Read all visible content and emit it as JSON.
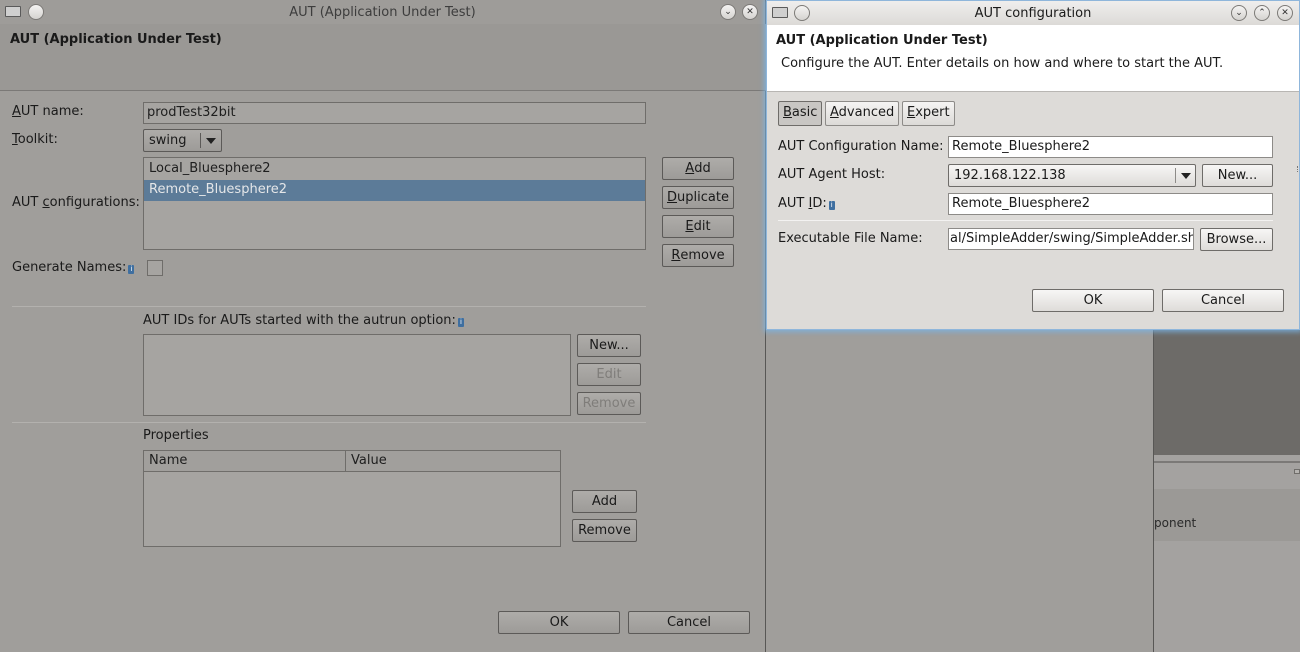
{
  "left_dialog": {
    "title": "AUT (Application Under Test)",
    "header_title": "AUT (Application Under Test)",
    "aut_name": {
      "label_u": "A",
      "label_rest": "UT name:",
      "value": "prodTest32bit"
    },
    "toolkit": {
      "label_u": "T",
      "label_rest": "oolkit:",
      "value": "swing"
    },
    "configs": {
      "label_pre": "AUT ",
      "label_u": "c",
      "label_rest": "onfigurations:",
      "items": [
        "Local_Bluesphere2",
        "Remote_Bluesphere2"
      ],
      "selected_index": 1
    },
    "config_buttons": {
      "add_u": "A",
      "add_rest": "dd",
      "duplicate_u": "D",
      "duplicate_rest": "uplicate",
      "edit_u": "E",
      "edit_rest": "dit",
      "remove_u": "R",
      "remove_rest": "emove"
    },
    "generate_names_label": "Generate Names:",
    "autrun_label": "AUT IDs for AUTs started with the autrun option:",
    "autrun_buttons": {
      "new": "New...",
      "edit": "Edit",
      "remove": "Remove"
    },
    "properties": {
      "label": "Properties",
      "columns": [
        "Name",
        "Value"
      ],
      "add": "Add",
      "remove": "Remove"
    },
    "ok": "OK",
    "cancel": "Cancel"
  },
  "background": {
    "component_text": "ponent"
  },
  "right_dialog": {
    "title": "AUT configuration",
    "header_title": "AUT (Application Under Test)",
    "header_desc": "Configure the AUT. Enter details on how and where to start the AUT.",
    "tabs": [
      {
        "u": "B",
        "rest": "asic",
        "active": true
      },
      {
        "u": "A",
        "rest": "dvanced",
        "active": false
      },
      {
        "u": "E",
        "rest": "xpert",
        "active": false
      }
    ],
    "config_name": {
      "label": "AUT Configuration Name:",
      "value": "Remote_Bluesphere2"
    },
    "agent_host": {
      "label": "AUT Agent Host:",
      "value": "192.168.122.138",
      "new_button": "New..."
    },
    "aut_id": {
      "label_pre": "AUT ",
      "label_u": "I",
      "label_rest": "D:",
      "value": "Remote_Bluesphere2"
    },
    "executable": {
      "label": "Executable File Name:",
      "value": "al/SimpleAdder/swing/SimpleAdder.sh",
      "browse_button": "Browse..."
    },
    "ok": "OK",
    "cancel": "Cancel"
  },
  "colors": {
    "selection": "#5c7b98",
    "focus_glow": "#7ab4e6"
  }
}
